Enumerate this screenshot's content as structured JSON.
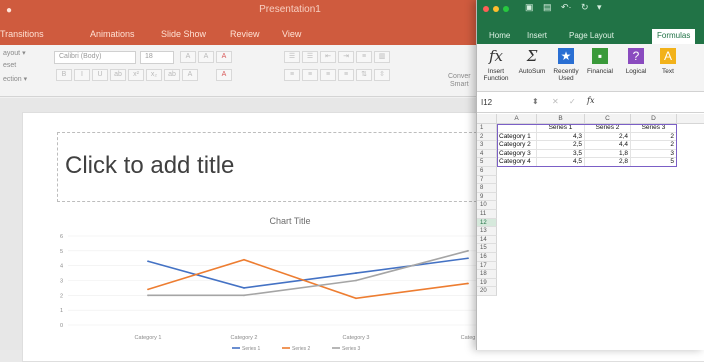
{
  "ppt": {
    "window_title": "Presentation1",
    "tabs": [
      "Transitions",
      "Animations",
      "Slide Show",
      "Review",
      "View"
    ],
    "ribbon": {
      "layout_label": "ayout ▾",
      "reset_label": "eset",
      "section_label": "ection ▾",
      "font_name": "Calibri (Body)",
      "font_size": "18",
      "convert_label": "Conver",
      "smart_label": "Smart"
    },
    "title_placeholder": "Click to add title"
  },
  "chart_data": {
    "type": "line",
    "title": "Chart Title",
    "categories": [
      "Category 1",
      "Category 2",
      "Category 3",
      "Categ"
    ],
    "ylim": [
      0,
      6
    ],
    "y_ticks": [
      "6",
      "5",
      "4",
      "3",
      "2",
      "1",
      "0"
    ],
    "legend_placement": "bottom",
    "series": [
      {
        "name": "Series 1",
        "color": "#4472c4",
        "values": [
          4.3,
          2.5,
          3.5,
          4.5
        ]
      },
      {
        "name": "Series 2",
        "color": "#ed7d31",
        "values": [
          2.4,
          4.4,
          1.8,
          2.8
        ]
      },
      {
        "name": "Series 3",
        "color": "#a5a5a5",
        "values": [
          2.0,
          2.0,
          3.0,
          5.0
        ]
      }
    ]
  },
  "excel": {
    "tabs": [
      "Home",
      "Insert",
      "Page Layout",
      "Formulas"
    ],
    "active_tab": "Formulas",
    "ribbon": [
      {
        "glyph": "fx",
        "label": "Insert Function",
        "color": ""
      },
      {
        "glyph": "Σ",
        "label": "AutoSum",
        "color": ""
      },
      {
        "glyph": "★",
        "label": "Recently Used",
        "color": "#2a6fd3"
      },
      {
        "glyph": "▪",
        "label": "Financial",
        "color": "#3a9a3a"
      },
      {
        "glyph": "?",
        "label": "Logical",
        "color": "#8a4bbf"
      },
      {
        "glyph": "A",
        "label": "Text",
        "color": "#f2b21a"
      }
    ],
    "cell_ref": "I12",
    "formula_fx": "fx",
    "columns": [
      "A",
      "B",
      "C",
      "D"
    ],
    "rows": [
      "1",
      "2",
      "3",
      "4",
      "5",
      "6",
      "7",
      "8",
      "9",
      "10",
      "11",
      "12",
      "13",
      "14",
      "15",
      "16",
      "17",
      "18",
      "19",
      "20"
    ],
    "table": {
      "header": [
        "",
        "Series 1",
        "Series 2",
        "Series 3"
      ],
      "rows": [
        [
          "Category 1",
          "4,3",
          "2,4",
          "2"
        ],
        [
          "Category 2",
          "2,5",
          "4,4",
          "2"
        ],
        [
          "Category 3",
          "3,5",
          "1,8",
          "3"
        ],
        [
          "Category 4",
          "4,5",
          "2,8",
          "5"
        ]
      ]
    }
  }
}
